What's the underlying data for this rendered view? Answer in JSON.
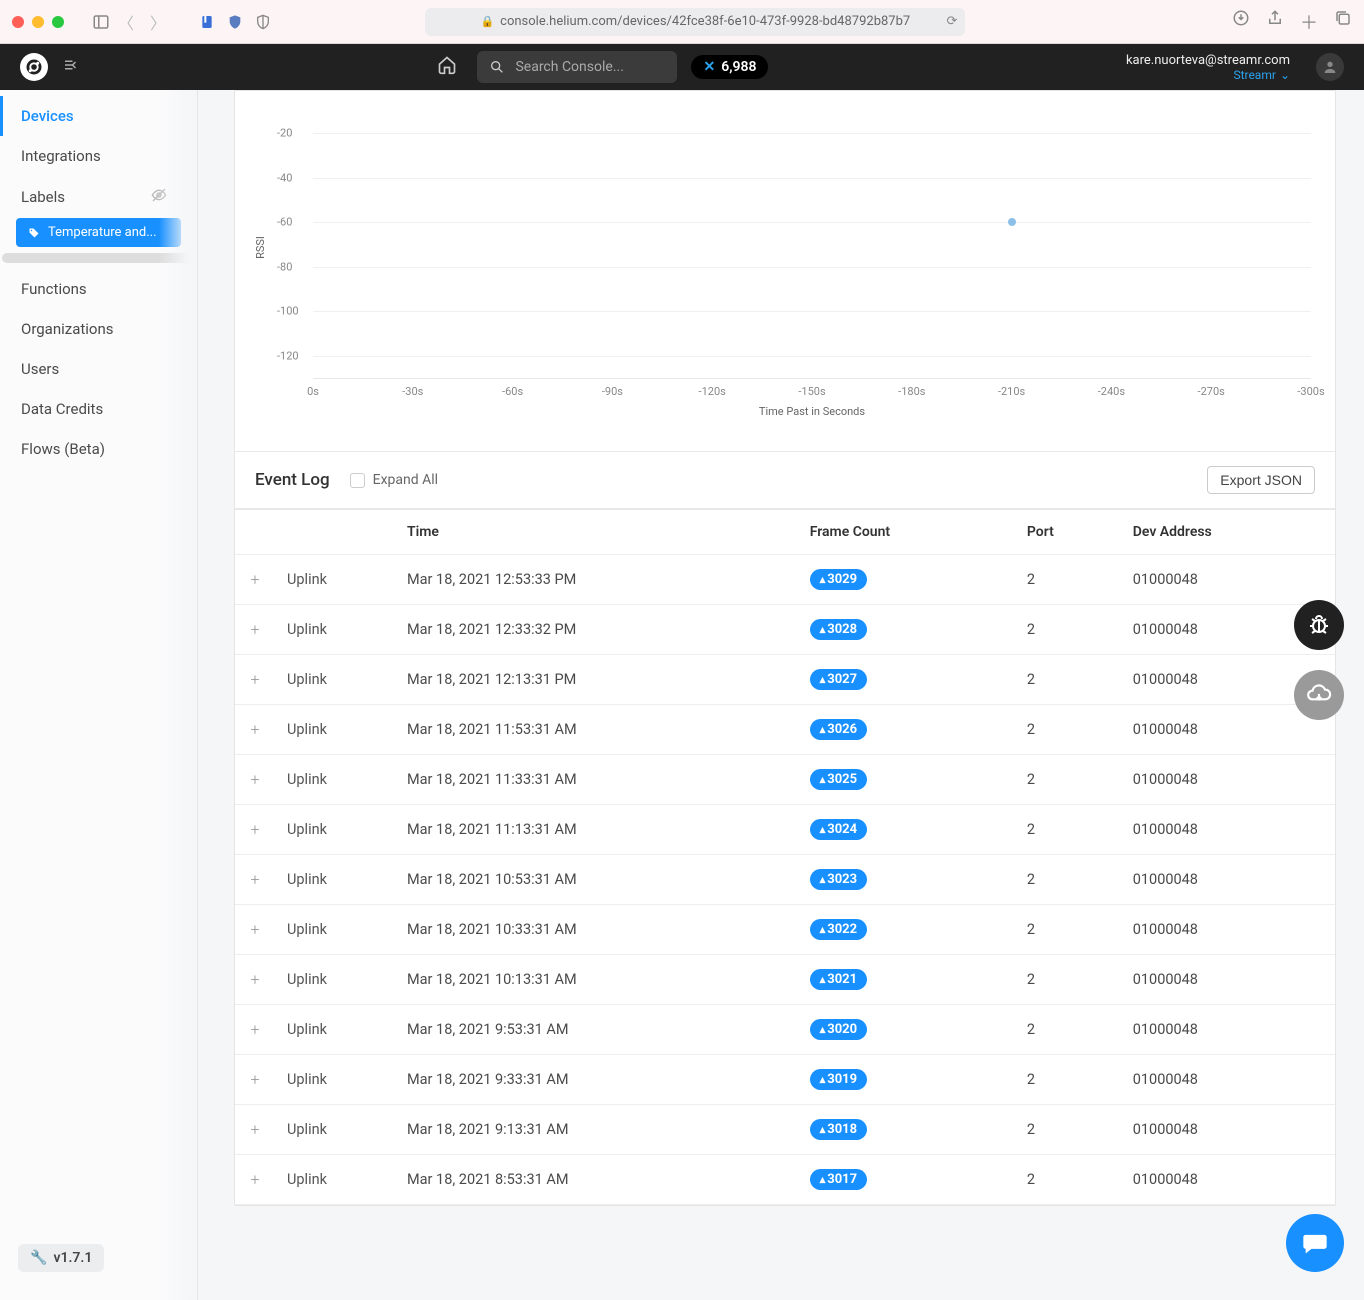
{
  "browser": {
    "url": "console.helium.com/devices/42fce38f-6e10-473f-9928-bd48792b87b7"
  },
  "header": {
    "search_placeholder": "Search Console...",
    "dc_balance": "6,988",
    "user_email": "kare.nuorteva@streamr.com",
    "org_name": "Streamr"
  },
  "sidebar": {
    "items": [
      "Devices",
      "Integrations",
      "Labels",
      "Functions",
      "Organizations",
      "Users",
      "Data Credits",
      "Flows (Beta)"
    ],
    "sub_label": "Temperature and...",
    "version": "v1.7.1"
  },
  "chart_data": {
    "type": "scatter",
    "ylabel": "RSSI",
    "xlabel": "Time Past in Seconds",
    "yticks": [
      -20,
      -40,
      -60,
      -80,
      -100,
      -120
    ],
    "xticks": [
      "0s",
      "-30s",
      "-60s",
      "-90s",
      "-120s",
      "-150s",
      "-180s",
      "-210s",
      "-240s",
      "-270s",
      "-300s"
    ],
    "points": [
      {
        "x": -210,
        "y": -60
      }
    ],
    "xrange": [
      0,
      -300
    ],
    "yrange": [
      -130,
      -10
    ]
  },
  "event_log": {
    "title": "Event Log",
    "expand_label": "Expand All",
    "export_label": "Export JSON",
    "columns": [
      "",
      "",
      "Time",
      "Frame Count",
      "Port",
      "Dev Address"
    ],
    "rows": [
      {
        "type": "Uplink",
        "time": "Mar 18, 2021 12:53:33 PM",
        "frame": "3029",
        "port": "2",
        "addr": "01000048"
      },
      {
        "type": "Uplink",
        "time": "Mar 18, 2021 12:33:32 PM",
        "frame": "3028",
        "port": "2",
        "addr": "01000048"
      },
      {
        "type": "Uplink",
        "time": "Mar 18, 2021 12:13:31 PM",
        "frame": "3027",
        "port": "2",
        "addr": "01000048"
      },
      {
        "type": "Uplink",
        "time": "Mar 18, 2021 11:53:31 AM",
        "frame": "3026",
        "port": "2",
        "addr": "01000048"
      },
      {
        "type": "Uplink",
        "time": "Mar 18, 2021 11:33:31 AM",
        "frame": "3025",
        "port": "2",
        "addr": "01000048"
      },
      {
        "type": "Uplink",
        "time": "Mar 18, 2021 11:13:31 AM",
        "frame": "3024",
        "port": "2",
        "addr": "01000048"
      },
      {
        "type": "Uplink",
        "time": "Mar 18, 2021 10:53:31 AM",
        "frame": "3023",
        "port": "2",
        "addr": "01000048"
      },
      {
        "type": "Uplink",
        "time": "Mar 18, 2021 10:33:31 AM",
        "frame": "3022",
        "port": "2",
        "addr": "01000048"
      },
      {
        "type": "Uplink",
        "time": "Mar 18, 2021 10:13:31 AM",
        "frame": "3021",
        "port": "2",
        "addr": "01000048"
      },
      {
        "type": "Uplink",
        "time": "Mar 18, 2021 9:53:31 AM",
        "frame": "3020",
        "port": "2",
        "addr": "01000048"
      },
      {
        "type": "Uplink",
        "time": "Mar 18, 2021 9:33:31 AM",
        "frame": "3019",
        "port": "2",
        "addr": "01000048"
      },
      {
        "type": "Uplink",
        "time": "Mar 18, 2021 9:13:31 AM",
        "frame": "3018",
        "port": "2",
        "addr": "01000048"
      },
      {
        "type": "Uplink",
        "time": "Mar 18, 2021 8:53:31 AM",
        "frame": "3017",
        "port": "2",
        "addr": "01000048"
      }
    ]
  }
}
